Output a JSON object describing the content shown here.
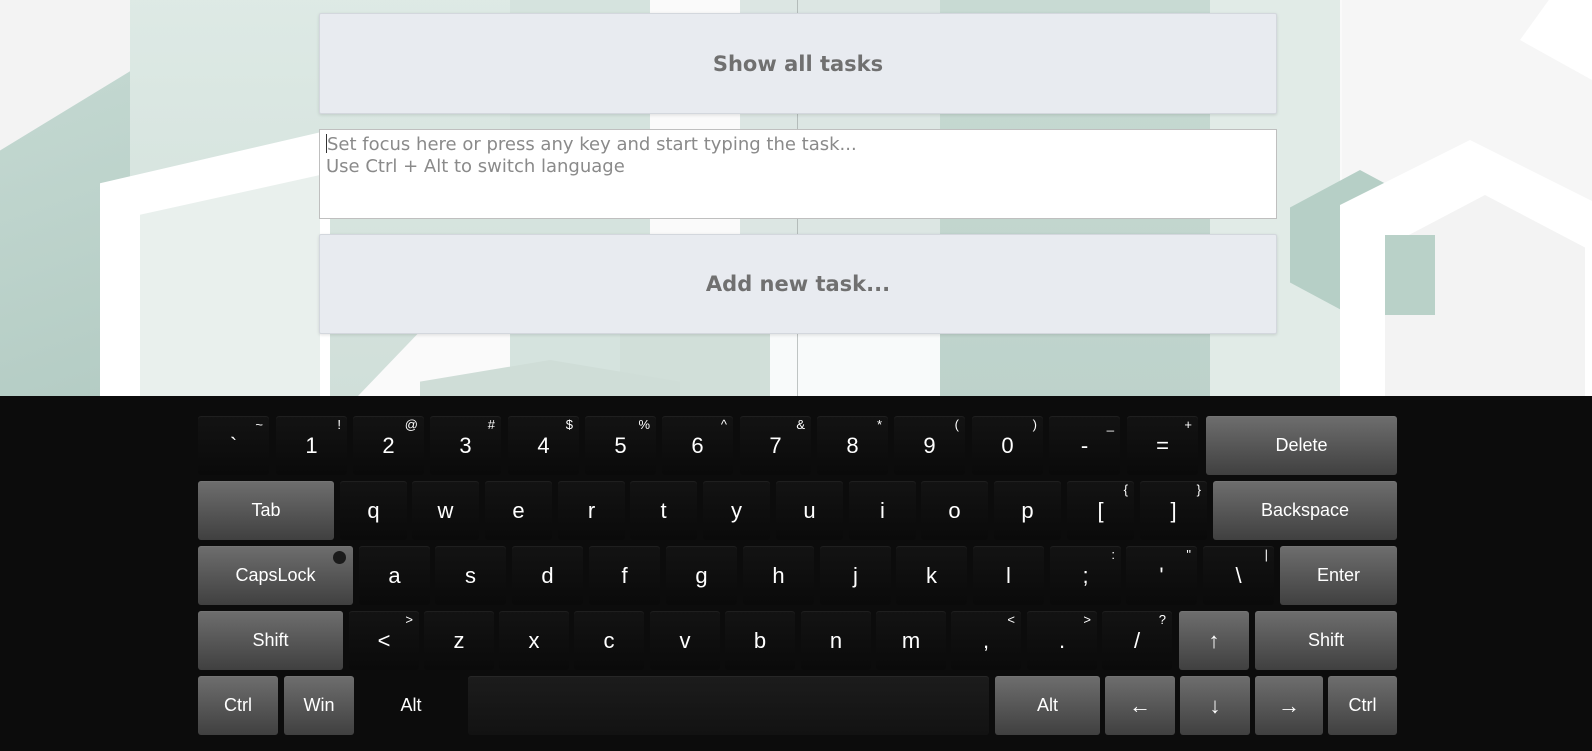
{
  "header": {
    "show_all_label": "Show all tasks",
    "input_placeholder_line1": "Set focus here or press any key and start typing the task...",
    "input_placeholder_line2": "Use Ctrl + Alt to switch language",
    "add_new_label": "Add new task..."
  },
  "keyboard": {
    "row1": [
      {
        "main": "`",
        "shift": "~"
      },
      {
        "main": "1",
        "shift": "!"
      },
      {
        "main": "2",
        "shift": "@"
      },
      {
        "main": "3",
        "shift": "#"
      },
      {
        "main": "4",
        "shift": "$"
      },
      {
        "main": "5",
        "shift": "%"
      },
      {
        "main": "6",
        "shift": "^"
      },
      {
        "main": "7",
        "shift": "&"
      },
      {
        "main": "8",
        "shift": "*"
      },
      {
        "main": "9",
        "shift": "("
      },
      {
        "main": "0",
        "shift": ")"
      },
      {
        "main": "-",
        "shift": "_"
      },
      {
        "main": "=",
        "shift": "+"
      }
    ],
    "delete": "Delete",
    "tab": "Tab",
    "row2": [
      {
        "main": "q",
        "shift": ""
      },
      {
        "main": "w",
        "shift": ""
      },
      {
        "main": "e",
        "shift": ""
      },
      {
        "main": "r",
        "shift": ""
      },
      {
        "main": "t",
        "shift": ""
      },
      {
        "main": "y",
        "shift": ""
      },
      {
        "main": "u",
        "shift": ""
      },
      {
        "main": "i",
        "shift": ""
      },
      {
        "main": "o",
        "shift": ""
      },
      {
        "main": "p",
        "shift": ""
      },
      {
        "main": "[",
        "shift": "{"
      },
      {
        "main": "]",
        "shift": "}"
      }
    ],
    "backspace": "Backspace",
    "capslock": "CapsLock",
    "row3": [
      {
        "main": "a",
        "shift": ""
      },
      {
        "main": "s",
        "shift": ""
      },
      {
        "main": "d",
        "shift": ""
      },
      {
        "main": "f",
        "shift": ""
      },
      {
        "main": "g",
        "shift": ""
      },
      {
        "main": "h",
        "shift": ""
      },
      {
        "main": "j",
        "shift": ""
      },
      {
        "main": "k",
        "shift": ""
      },
      {
        "main": "l",
        "shift": ""
      },
      {
        "main": ";",
        "shift": ":"
      },
      {
        "main": "'",
        "shift": "\""
      },
      {
        "main": "\\",
        "shift": "|"
      }
    ],
    "enter": "Enter",
    "shift_left": "Shift",
    "row4": [
      {
        "main": "<",
        "shift": ">"
      },
      {
        "main": "z",
        "shift": ""
      },
      {
        "main": "x",
        "shift": ""
      },
      {
        "main": "c",
        "shift": ""
      },
      {
        "main": "v",
        "shift": ""
      },
      {
        "main": "b",
        "shift": ""
      },
      {
        "main": "n",
        "shift": ""
      },
      {
        "main": "m",
        "shift": ""
      },
      {
        "main": ",",
        "shift": "<"
      },
      {
        "main": ".",
        "shift": ">"
      },
      {
        "main": "/",
        "shift": "?"
      }
    ],
    "arrow_up": "↑",
    "shift_right": "Shift",
    "ctrl_left": "Ctrl",
    "win": "Win",
    "alt_left": "Alt",
    "space": "",
    "alt_right": "Alt",
    "arrow_left": "←",
    "arrow_down": "↓",
    "arrow_right": "→",
    "ctrl_right": "Ctrl"
  }
}
